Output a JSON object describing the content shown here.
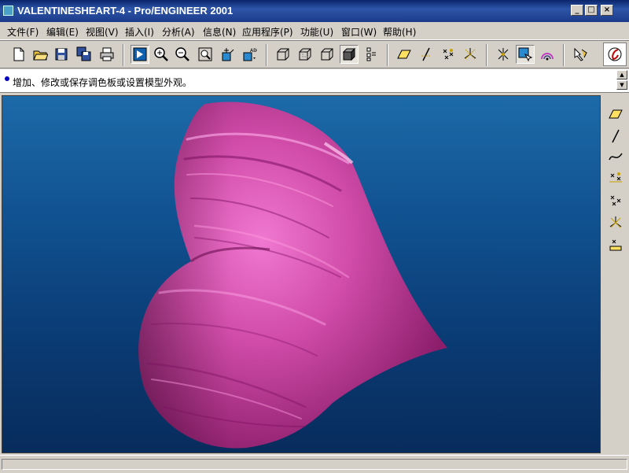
{
  "window": {
    "title": "VALENTINESHEART-4 - Pro/ENGINEER 2001"
  },
  "menubar": [
    {
      "label": "文件(F)",
      "name": "menu-file"
    },
    {
      "label": "编辑(E)",
      "name": "menu-edit"
    },
    {
      "label": "视图(V)",
      "name": "menu-view"
    },
    {
      "label": "插入(I)",
      "name": "menu-insert"
    },
    {
      "label": "分析(A)",
      "name": "menu-analysis"
    },
    {
      "label": "信息(N)",
      "name": "menu-info"
    },
    {
      "label": "应用程序(P)",
      "name": "menu-applications"
    },
    {
      "label": "功能(U)",
      "name": "menu-utilities"
    },
    {
      "label": "窗口(W)",
      "name": "menu-window"
    },
    {
      "label": "帮助(H)",
      "name": "menu-help"
    }
  ],
  "toolbar": {
    "icons": [
      "new-file-icon",
      "open-file-icon",
      "save-icon",
      "save-copy-icon",
      "print-icon",
      "repaint-icon",
      "zoom-in-icon",
      "zoom-out-icon",
      "refit-icon",
      "orient-icon",
      "saved-views-icon",
      "wireframe-icon",
      "hidden-line-icon",
      "no-hidden-icon",
      "shading-icon",
      "datum-display-icon",
      "datum-plane-icon",
      "datum-axis-icon",
      "datum-point-icon",
      "coordinate-system-icon",
      "spin-center-icon",
      "selection-filter-icon",
      "model-tree-icon",
      "whats-this-icon",
      "proe-logo-icon"
    ]
  },
  "message": {
    "text": "增加、修改或保存调色板或设置模型外观。"
  },
  "rightbar": {
    "icons": [
      "datum-plane-tool-icon",
      "datum-axis-tool-icon",
      "datum-curve-tool-icon",
      "datum-point-tool-icon",
      "point-offset-tool-icon",
      "csys-tool-icon",
      "analysis-tool-icon"
    ]
  },
  "colors": {
    "model": "#c8489a",
    "viewport_top": "#1d6aa8",
    "viewport_bottom": "#082c5c"
  }
}
